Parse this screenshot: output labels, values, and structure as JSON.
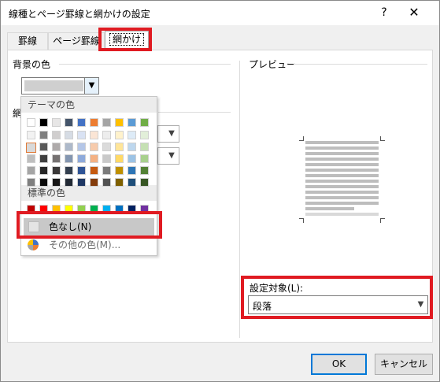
{
  "dialog": {
    "title": "線種とページ罫線と網かけの設定",
    "help": "?",
    "close": "✕"
  },
  "tabs": [
    "罫線",
    "ページ罫線",
    "網かけ"
  ],
  "fill": {
    "label": "背景の色",
    "selected_color": "#cfcfcf"
  },
  "pattern_label_partial": "網",
  "preview": {
    "label": "プレビュー"
  },
  "apply_to": {
    "label": "設定対象(L):",
    "value": "段落"
  },
  "buttons": {
    "ok": "OK",
    "cancel": "キャンセル"
  },
  "color_menu": {
    "theme_header": "テーマの色",
    "standard_header": "標準の色",
    "no_color": "色なし(N)",
    "more_colors": "その他の色(M)...",
    "theme_colors": [
      [
        "#ffffff",
        "#000000",
        "#e7e6e6",
        "#44546a",
        "#4472c4",
        "#ed7d31",
        "#a5a5a5",
        "#ffc000",
        "#5b9bd5",
        "#70ad47"
      ],
      [
        "#f2f2f2",
        "#7f7f7f",
        "#d0cece",
        "#d6dce4",
        "#d9e2f3",
        "#fbe5d5",
        "#ededed",
        "#fff2cc",
        "#ddebf7",
        "#e2efd9"
      ],
      [
        "#d9d9d9",
        "#595959",
        "#aeaaaa",
        "#adb9ca",
        "#b4c6e7",
        "#f7cbac",
        "#dbdbdb",
        "#ffe599",
        "#bdd7ee",
        "#c5e0b3"
      ],
      [
        "#bfbfbf",
        "#3f3f3f",
        "#757171",
        "#8496b0",
        "#8eaadb",
        "#f4b183",
        "#c9c9c9",
        "#ffd966",
        "#9cc3e5",
        "#a8d08d"
      ],
      [
        "#a5a5a5",
        "#262626",
        "#3a3838",
        "#333f4f",
        "#2f5496",
        "#c55a11",
        "#7b7b7b",
        "#bf9000",
        "#2e75b5",
        "#538135"
      ],
      [
        "#7f7f7f",
        "#0c0c0c",
        "#171616",
        "#222a35",
        "#1f3864",
        "#833c0b",
        "#525252",
        "#7f6000",
        "#1e4e79",
        "#375623"
      ]
    ],
    "standard_colors": [
      "#c00000",
      "#ff0000",
      "#ffc000",
      "#ffff00",
      "#92d050",
      "#00b050",
      "#00b0f0",
      "#0070c0",
      "#002060",
      "#7030a0"
    ]
  },
  "highlight_color": "#e01b22"
}
